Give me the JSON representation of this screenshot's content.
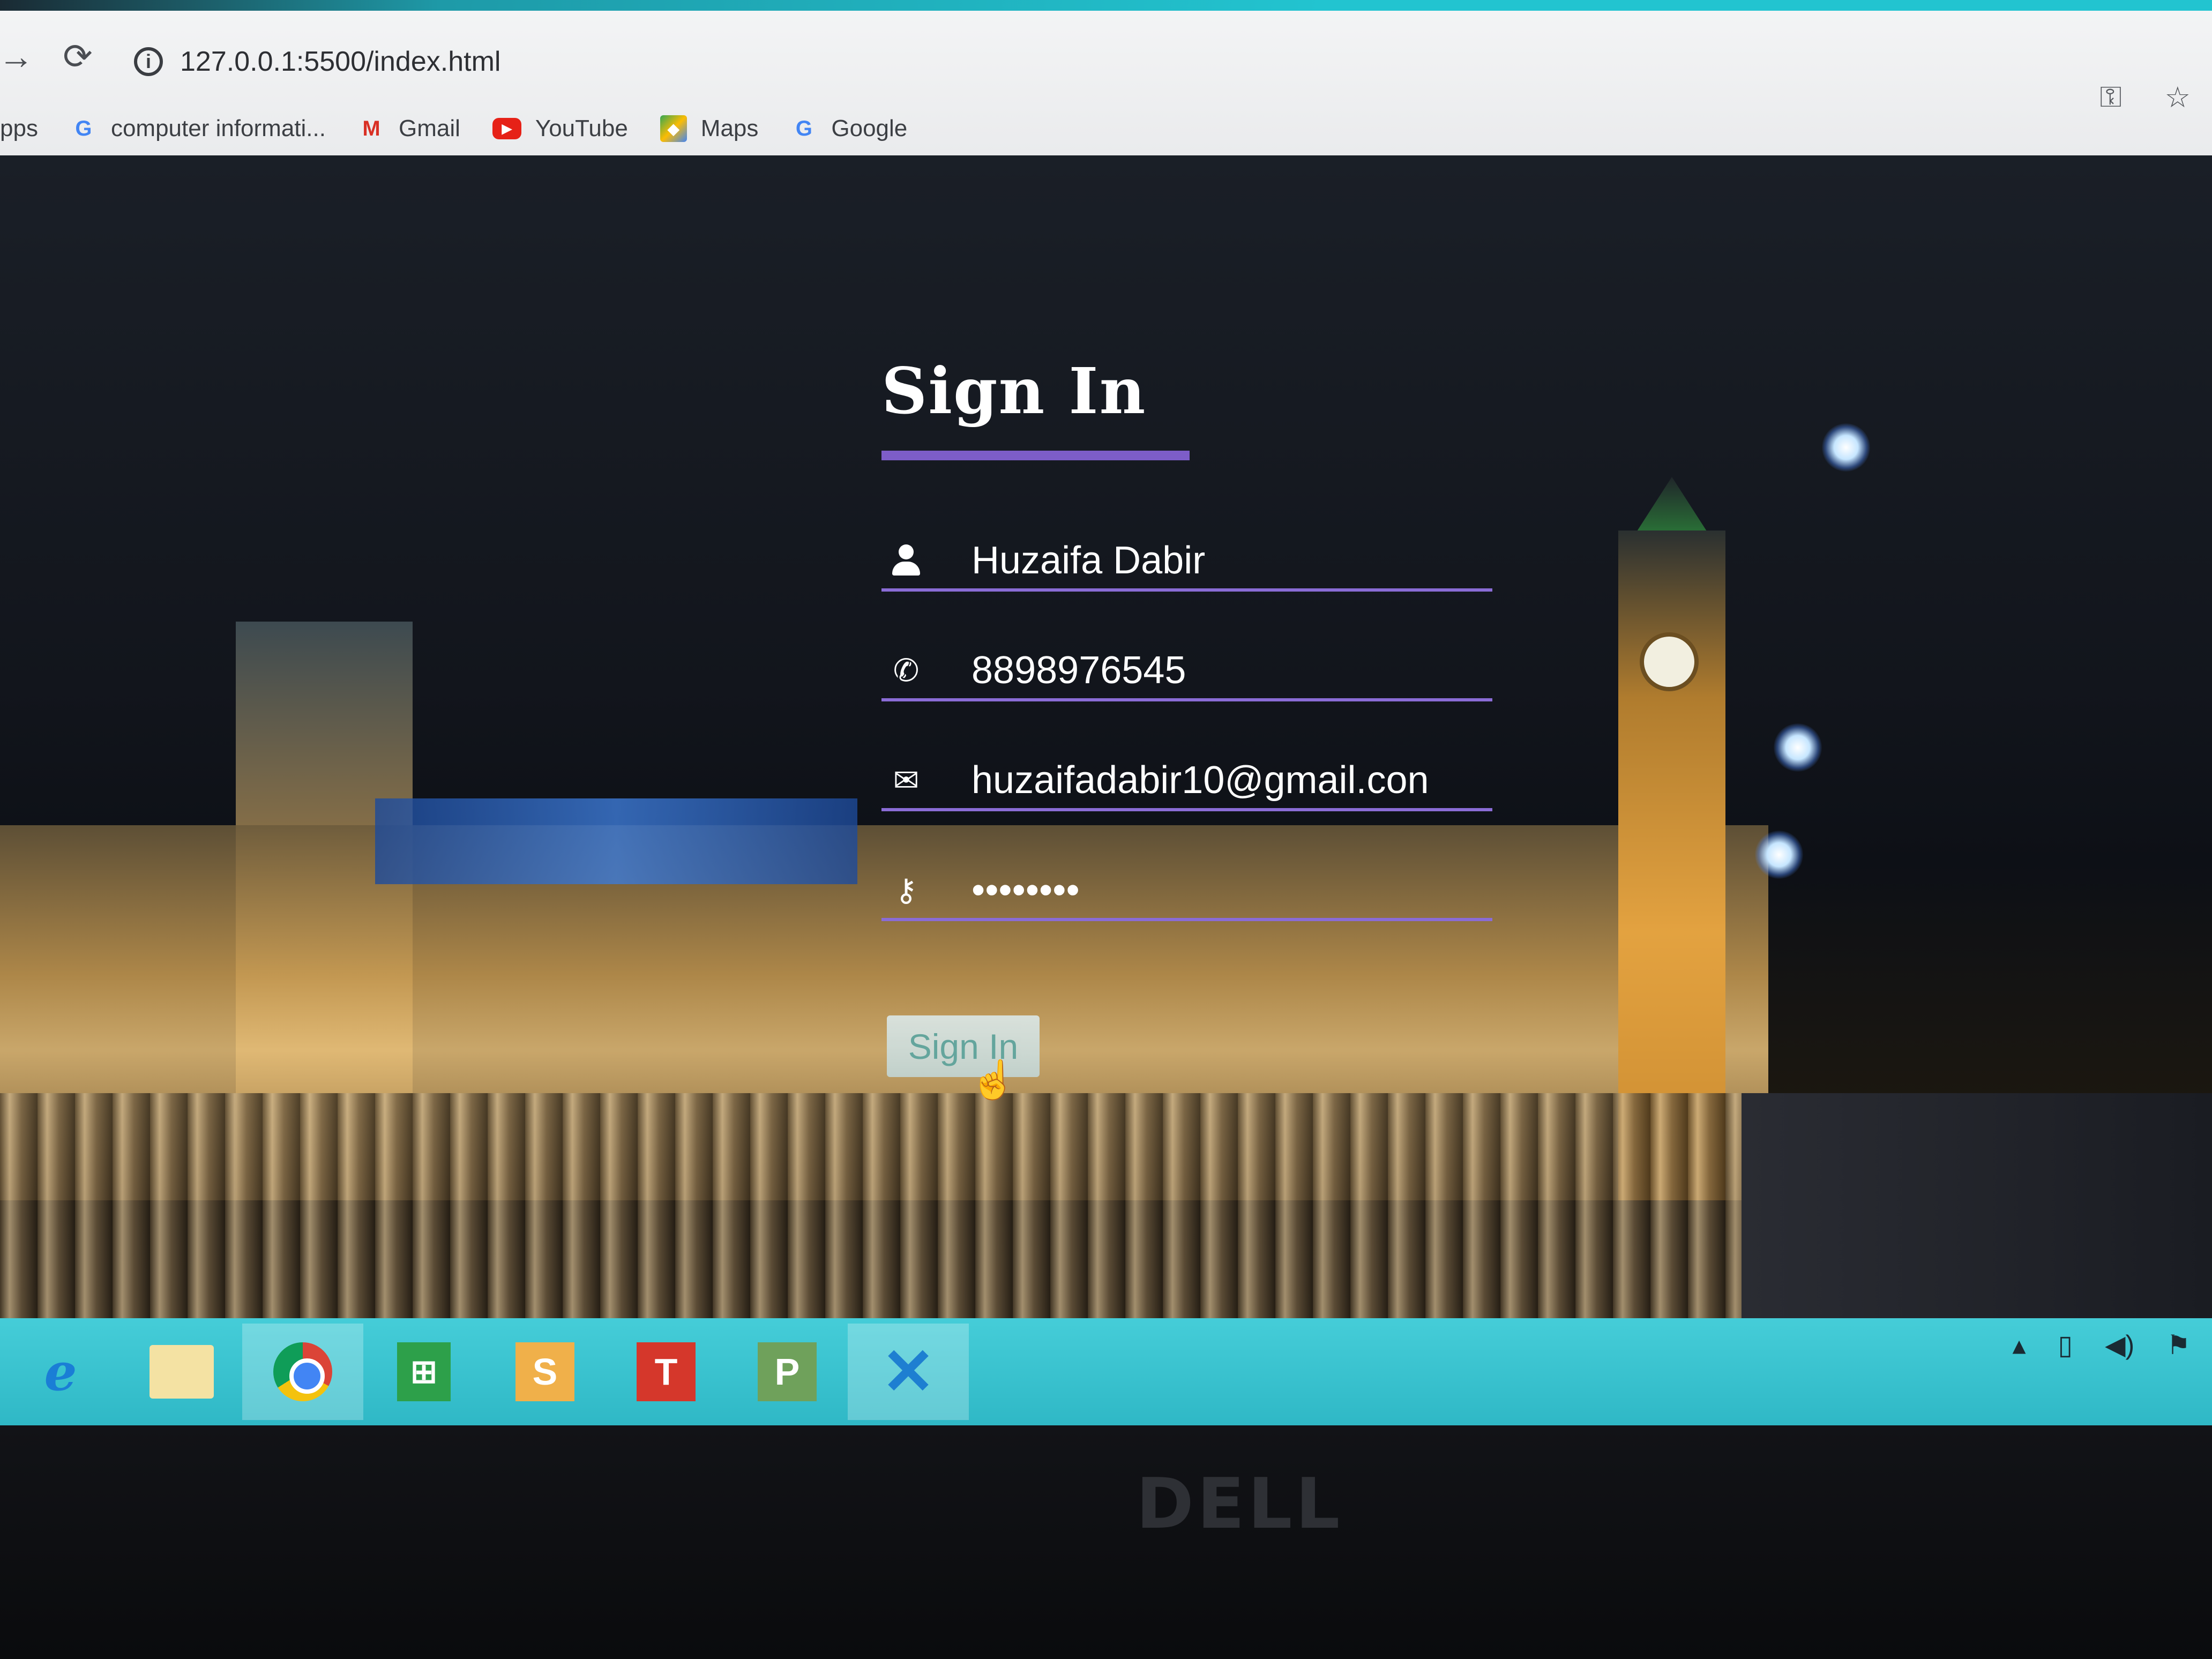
{
  "browser": {
    "url": "127.0.0.1:5500/index.html",
    "bookmarks": [
      {
        "label": "pps"
      },
      {
        "label": "computer informati...",
        "icon": "google-icon"
      },
      {
        "label": "Gmail",
        "icon": "gmail-icon"
      },
      {
        "label": "YouTube",
        "icon": "youtube-icon"
      },
      {
        "label": "Maps",
        "icon": "maps-icon"
      },
      {
        "label": "Google",
        "icon": "google-icon"
      }
    ]
  },
  "form": {
    "title": "Sign In",
    "name_value": "Huzaifa Dabir",
    "phone_value": "8898976545",
    "email_value": "huzaifadabir10@gmail.con",
    "password_value": "••••••••",
    "submit_label": "Sign In"
  },
  "taskbar": {
    "apps": [
      "internet-explorer-icon",
      "file-explorer-icon",
      "chrome-icon",
      "store-icon",
      "app-s-icon",
      "app-t-icon",
      "app-p-icon",
      "visual-studio-icon"
    ]
  },
  "device": {
    "brand": "DELL"
  },
  "colors": {
    "accent": "#7d5dc8",
    "taskbar": "#2fb8c6"
  }
}
